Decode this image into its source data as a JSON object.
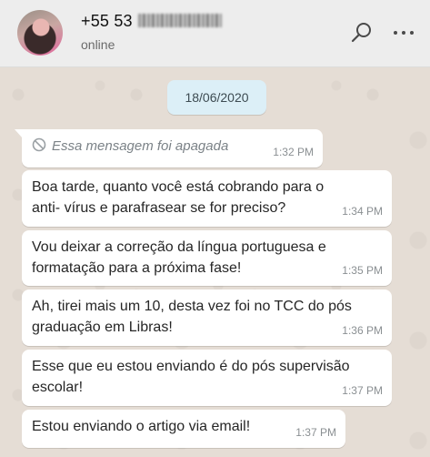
{
  "header": {
    "contact_name": "+55 53",
    "status": "online"
  },
  "chat": {
    "date_chip": "18/06/2020",
    "messages": [
      {
        "text": "Essa mensagem foi apagada",
        "time": "1:32 PM",
        "deleted": true
      },
      {
        "text": "Boa tarde, quanto você está cobrando para o anti- vírus e parafrasear se for preciso?",
        "time": "1:34 PM"
      },
      {
        "text": "Vou deixar a correção da língua portuguesa e formatação para a próxima fase!",
        "time": "1:35 PM"
      },
      {
        "text": "Ah, tirei mais um 10, desta vez foi no TCC do pós graduação em Libras!",
        "time": "1:36 PM"
      },
      {
        "text": "Esse que eu estou enviando é do pós supervisão escolar!",
        "time": "1:37 PM"
      },
      {
        "text": "Estou enviando o artigo via email!",
        "time": "1:37 PM"
      }
    ]
  },
  "icons": {
    "search": "search-icon",
    "menu": "more-options-icon",
    "deleted": "ban-icon"
  },
  "colors": {
    "header_bg": "#ededed",
    "chat_bg": "#e5ddd5",
    "bubble_bg": "#ffffff",
    "date_chip_bg": "#dceff7"
  }
}
